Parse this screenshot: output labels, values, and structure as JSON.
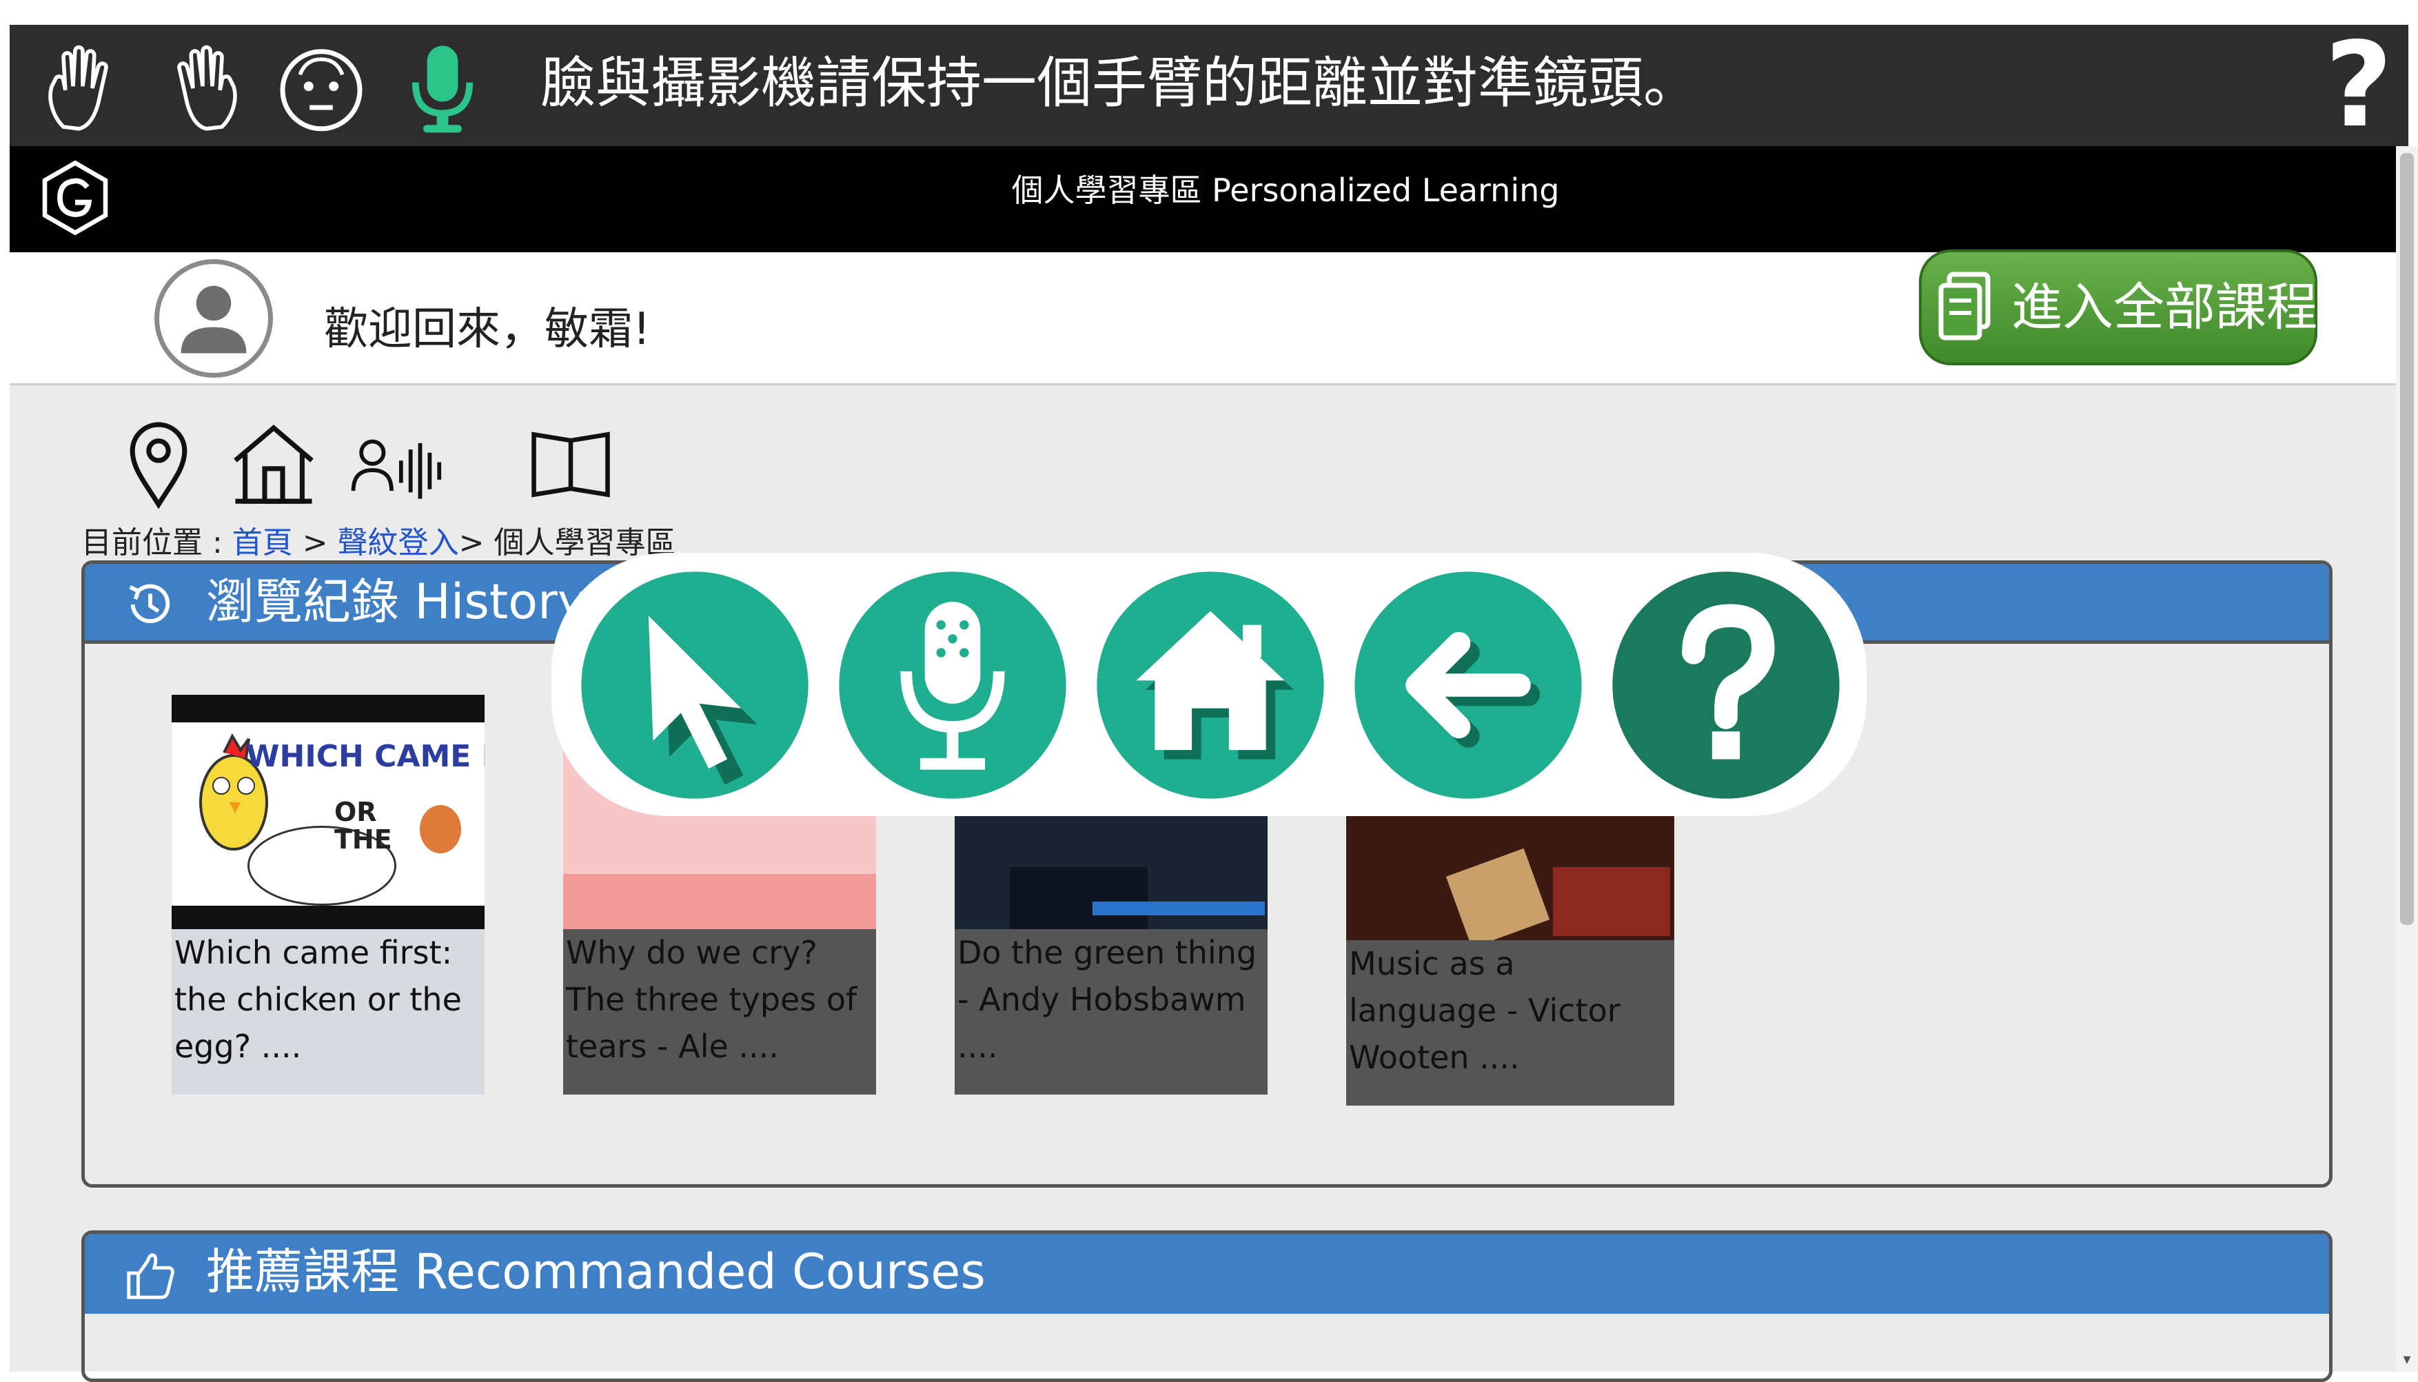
{
  "topbar": {
    "instruction": "臉與攝影機請保持一個手臂的距離並對準鏡頭。",
    "help_label": "?",
    "icons": [
      "hand-left-icon",
      "hand-right-icon",
      "face-icon",
      "microphone-icon",
      "help-icon"
    ]
  },
  "header": {
    "title": "個人學習專區 Personalized Learning",
    "logo": "G"
  },
  "welcome": {
    "text": "歡迎回來，敏霜!",
    "all_courses_label": "進入全部課程"
  },
  "nav_icons": [
    "location-pin-icon",
    "home-icon",
    "voiceprint-icon",
    "book-icon"
  ],
  "breadcrumb": {
    "prefix": "目前位置 : ",
    "home": "首頁",
    "sep1": " > ",
    "voice_login": "聲紋登入",
    "sep2": "> ",
    "current": "個人學習專區"
  },
  "history": {
    "title": "瀏覽紀錄 History",
    "cards": [
      {
        "title": "Which came first: the chicken or the egg? ....",
        "thumb_text_1": "WHICH CAME FIRST",
        "thumb_text_2": "OR THE"
      },
      {
        "title": "Why do we cry? The three types of tears - Ale ...."
      },
      {
        "title": "Do the green thing - Andy Hobsbawm ...."
      },
      {
        "title": "Music as a language - Victor Wooten ...."
      }
    ]
  },
  "recommended": {
    "title": "推薦課程 Recommanded Courses"
  },
  "floating_toolbar": {
    "buttons": [
      "cursor-icon",
      "microphone-icon",
      "home-icon",
      "back-arrow-icon",
      "help-icon"
    ],
    "help_glyph": "?",
    "colors": {
      "teal": "#1fae8f",
      "dark_teal": "#1b7a5e",
      "shadow": "#0f6f57"
    }
  },
  "colors": {
    "topbar": "#2d2d2d",
    "header": "#000000",
    "panel_head": "#3f7fc6",
    "content_bg": "#ebebeb",
    "all_courses_button": "#52a03a",
    "link": "#2255cc"
  }
}
